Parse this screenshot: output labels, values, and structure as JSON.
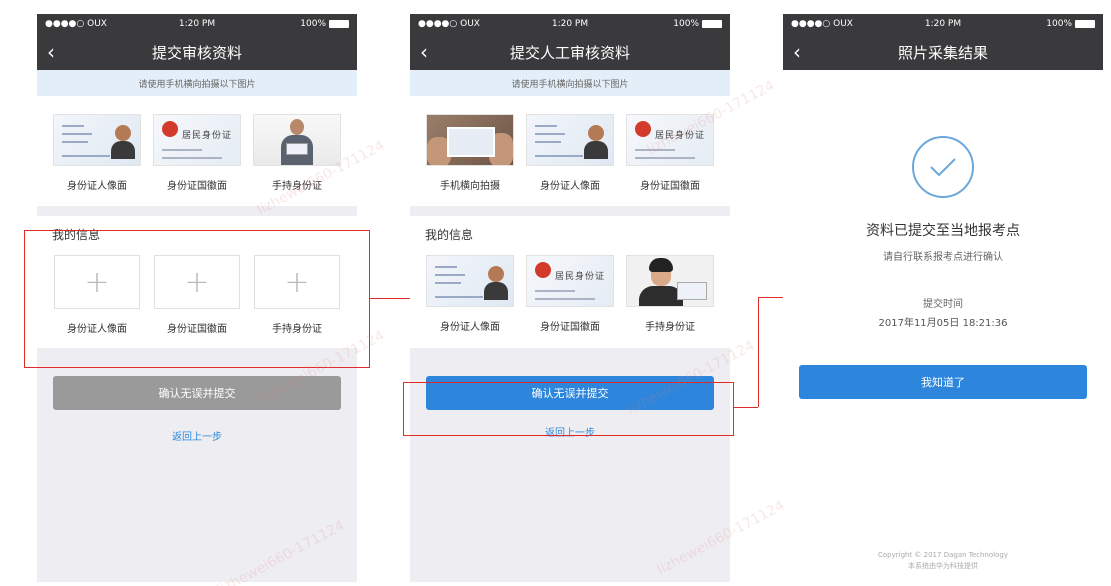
{
  "status_bar": {
    "carrier": "●●●●○ OUX",
    "time": "1:20 PM",
    "battery": "100%"
  },
  "screen1": {
    "title": "提交审核资料",
    "banner": "请使用手机横向拍摄以下图片",
    "samples": [
      "身份证人像面",
      "身份证国徽面",
      "手持身份证"
    ],
    "section_title": "我的信息",
    "upload_labels": [
      "身份证人像面",
      "身份证国徽面",
      "手持身份证"
    ],
    "plus": "+",
    "submit_label": "确认无误并提交",
    "back_link": "返回上一步"
  },
  "screen2": {
    "title": "提交人工审核资料",
    "banner": "请使用手机横向拍摄以下图片",
    "samples": [
      "手机横向拍摄",
      "身份证人像面",
      "身份证国徽面"
    ],
    "section_title": "我的信息",
    "uploaded_labels": [
      "身份证人像面",
      "身份证国徽面",
      "手持身份证"
    ],
    "submit_label": "确认无误并提交",
    "back_link": "返回上一步"
  },
  "screen3": {
    "title": "照片采集结果",
    "heading": "资料已提交至当地报考点",
    "subheading": "请自行联系报考点进行确认",
    "time_label": "提交时间",
    "time_value": "2017年11月05日 18:21:36",
    "ok_label": "我知道了",
    "footer_line1": "Copyright © 2017 Dagan Technology",
    "footer_line2": "本系统由华为科技提供"
  },
  "id_card_text": "居民身份证",
  "watermark": "lizhewei660-171124",
  "colors": {
    "nav_bg": "#3a3a3c",
    "primary": "#2d86db",
    "disabled": "#9a9a9a",
    "annotation": "#e02b2b"
  }
}
